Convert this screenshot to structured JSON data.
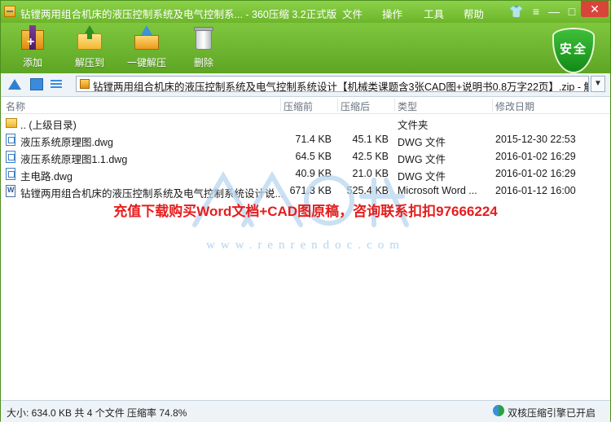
{
  "window": {
    "title": "钻镗两用组合机床的液压控制系统及电气控制系... - 360压缩 3.2正式版",
    "menus": [
      "文件",
      "操作",
      "工具",
      "帮助"
    ],
    "controls": {
      "skin": "👕",
      "menu": "≡",
      "minimize": "—",
      "maximize": "□",
      "close": "✕"
    }
  },
  "toolbar": {
    "add": "添加",
    "extract": "解压到",
    "one_click": "一键解压",
    "delete": "删除",
    "shield_label": "安全"
  },
  "address": {
    "path": "钻镗两用组合机床的液压控制系统及电气控制系统设计【机械类课题含3张CAD图+说明书0.8万字22页】.zip - 解",
    "dropdown": "▼"
  },
  "columns": {
    "name": "名称",
    "before": "压缩前",
    "after": "压缩后",
    "type": "类型",
    "modified": "修改日期"
  },
  "files": [
    {
      "icon": "folder",
      "name": ".. (上级目录)",
      "before": "",
      "after": "",
      "type": "文件夹",
      "modified": ""
    },
    {
      "icon": "dwg",
      "name": "液压系统原理图.dwg",
      "before": "71.4 KB",
      "after": "45.1 KB",
      "type": "DWG 文件",
      "modified": "2015-12-30 22:53"
    },
    {
      "icon": "dwg",
      "name": "液压系统原理图1.1.dwg",
      "before": "64.5 KB",
      "after": "42.5 KB",
      "type": "DWG 文件",
      "modified": "2016-01-02 16:29"
    },
    {
      "icon": "dwg",
      "name": "主电路.dwg",
      "before": "40.9 KB",
      "after": "21.0 KB",
      "type": "DWG 文件",
      "modified": "2016-01-02 16:29"
    },
    {
      "icon": "doc",
      "name": "钻镗两用组合机床的液压控制系统及电气控制系统设计说...",
      "before": "671.3 KB",
      "after": "525.4 KB",
      "type": "Microsoft Word ...",
      "modified": "2016-01-12 16:00"
    }
  ],
  "overlay": {
    "promo": "充值下载购买Word文档+CAD图原稿，咨询联系扣扣97666224",
    "watermark_url": "www.renrendoc.com"
  },
  "status": {
    "summary": "大小: 634.0 KB 共 4 个文件 压缩率 74.8%",
    "engine": "双核压缩引擎已开启"
  },
  "colors": {
    "accent": "#6cb52a",
    "promo": "#e51d1d"
  }
}
